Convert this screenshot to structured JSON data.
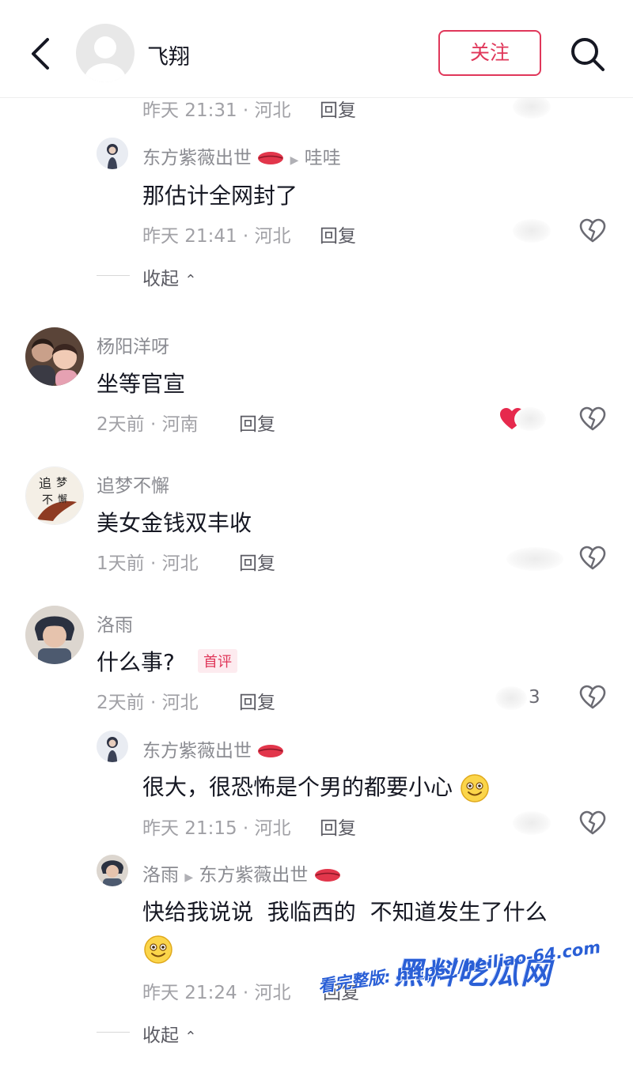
{
  "header": {
    "title": "飞翔",
    "follow_label": "关注"
  },
  "thread1": {
    "prev_reply": {
      "meta": "昨天 21:31 · 河北",
      "reply_label": "回复"
    },
    "reply": {
      "author": "东方紫薇出世",
      "target": "哇哇",
      "text": "那估计全网封了",
      "meta": "昨天 21:41 · 河北",
      "reply_label": "回复"
    },
    "collapse_label": "收起"
  },
  "comments": [
    {
      "author": "杨阳洋呀",
      "text": "坐等官宣",
      "meta": "2天前 · 河南",
      "reply_label": "回复"
    },
    {
      "author": "追梦不懈",
      "text": "美女金钱双丰收",
      "meta": "1天前 · 河北",
      "reply_label": "回复"
    },
    {
      "author": "洛雨",
      "text": "什么事?",
      "badge": "首评",
      "meta": "2天前 · 河北",
      "reply_label": "回复",
      "like_count": "3"
    }
  ],
  "thread2": {
    "reply1": {
      "author": "东方紫薇出世",
      "text": "很大，很恐怖是个男的都要小心",
      "meta": "昨天 21:15 · 河北",
      "reply_label": "回复"
    },
    "reply2": {
      "author": "洛雨",
      "target": "东方紫薇出世",
      "text": "快给我说说  我临西的  不知道发生了什么",
      "meta": "昨天 21:24 · 河北",
      "reply_label": "回复"
    },
    "collapse_label": "收起"
  },
  "avatar_text": {
    "zhuimeng_1": "追",
    "zhuimeng_2": "梦",
    "zhuimeng_3": "不",
    "zhuimeng_4": "懈"
  },
  "watermark": {
    "title": "黑料吃瓜网",
    "url_line": "看完整版: https://heiliao-64.com"
  },
  "colors": {
    "accent": "#e0375a",
    "text": "#161823",
    "meta": "#a1a1a6",
    "watermark": "#2a5fd6"
  }
}
